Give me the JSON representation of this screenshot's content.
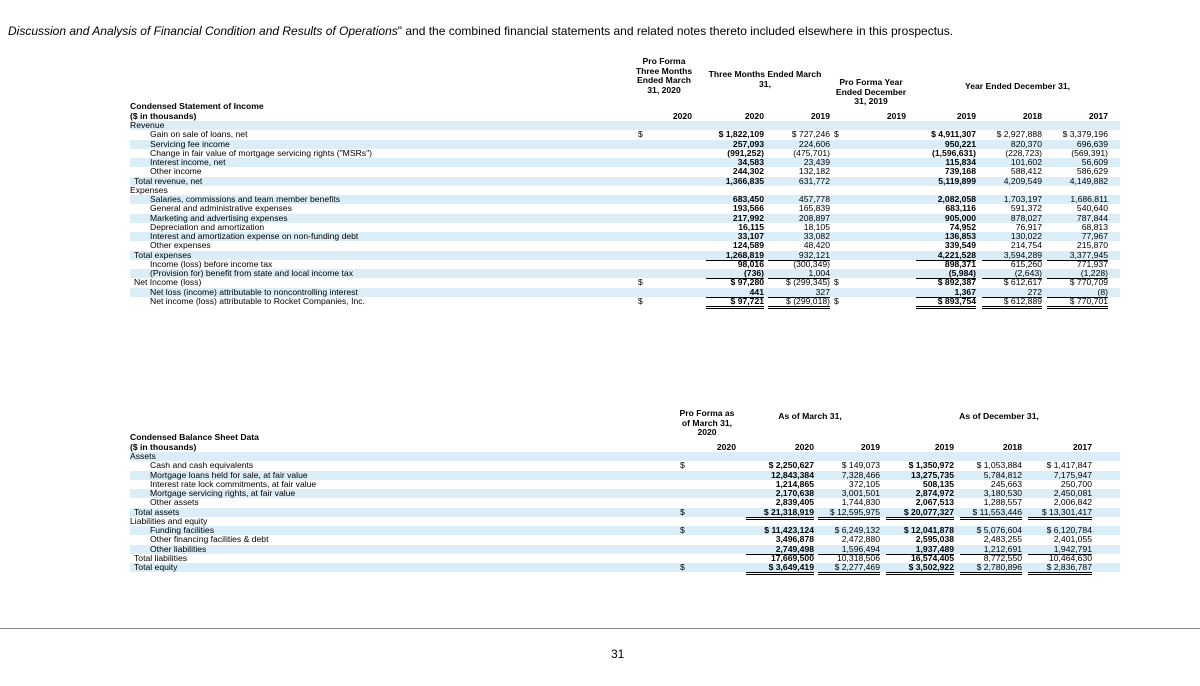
{
  "intro": {
    "italic": "Discussion and Analysis of Financial Condition and Results of Operations",
    "rest": "\" and the combined financial statements and related notes thereto included elsewhere in this prospectus."
  },
  "income": {
    "title": "Condensed Statement of Income",
    "unit": "($ in thousands)",
    "hdr_proforma_q": "Pro Forma Three Months Ended March 31, 2020",
    "hdr_three_months": "Three Months Ended March 31,",
    "hdr_proforma_y": "Pro Forma Year Ended December 31, 2019",
    "hdr_year_ended": "Year Ended December 31,",
    "cols": [
      "2020",
      "2019",
      "2019",
      "2018",
      "2017"
    ],
    "rows": [
      {
        "label": "Revenue",
        "indent": 0,
        "pf": "",
        "c2020": "",
        "c2019": "",
        "pfy": "",
        "y2019": "",
        "y2018": "",
        "y2017": ""
      },
      {
        "label": "Gain on sale of loans, net",
        "indent": 2,
        "pf": "$",
        "c2020": "$ 1,822,109",
        "c2019": "$ 727,246",
        "pfy": "$",
        "y2019": "$ 4,911,307",
        "y2018": "$ 2,927,888",
        "y2017": "$ 3,379,196"
      },
      {
        "label": "Servicing fee income",
        "indent": 2,
        "pf": "",
        "c2020": "257,093",
        "c2019": "224,606",
        "pfy": "",
        "y2019": "950,221",
        "y2018": "820,370",
        "y2017": "696,639"
      },
      {
        "label": "Change in fair value of mortgage servicing rights (\"MSRs\")",
        "indent": 2,
        "pf": "",
        "c2020": "(991,252)",
        "c2019": "(475,701)",
        "pfy": "",
        "y2019": "(1,596,631)",
        "y2018": "(228,723)",
        "y2017": "(569,391)"
      },
      {
        "label": "Interest income, net",
        "indent": 2,
        "pf": "",
        "c2020": "34,583",
        "c2019": "23,439",
        "pfy": "",
        "y2019": "115,834",
        "y2018": "101,602",
        "y2017": "56,609"
      },
      {
        "label": "Other income",
        "indent": 2,
        "pf": "",
        "c2020": "244,302",
        "c2019": "132,182",
        "pfy": "",
        "y2019": "739,168",
        "y2018": "588,412",
        "y2017": "586,629",
        "ul": true
      },
      {
        "label": "Total revenue, net",
        "indent": 1,
        "pf": "",
        "c2020": "1,366,835",
        "c2019": "631,772",
        "pfy": "",
        "y2019": "5,119,899",
        "y2018": "4,209,549",
        "y2017": "4,149,882"
      },
      {
        "label": "Expenses",
        "indent": 0,
        "pf": "",
        "c2020": "",
        "c2019": "",
        "pfy": "",
        "y2019": "",
        "y2018": "",
        "y2017": ""
      },
      {
        "label": "Salaries, commissions and team member benefits",
        "indent": 2,
        "pf": "",
        "c2020": "683,450",
        "c2019": "457,778",
        "pfy": "",
        "y2019": "2,082,058",
        "y2018": "1,703,197",
        "y2017": "1,686,811"
      },
      {
        "label": "General and administrative expenses",
        "indent": 2,
        "pf": "",
        "c2020": "193,566",
        "c2019": "165,839",
        "pfy": "",
        "y2019": "683,116",
        "y2018": "591,372",
        "y2017": "540,640"
      },
      {
        "label": "Marketing and advertising expenses",
        "indent": 2,
        "pf": "",
        "c2020": "217,992",
        "c2019": "208,897",
        "pfy": "",
        "y2019": "905,000",
        "y2018": "878,027",
        "y2017": "787,844"
      },
      {
        "label": "Depreciation and amortization",
        "indent": 2,
        "pf": "",
        "c2020": "16,115",
        "c2019": "18,105",
        "pfy": "",
        "y2019": "74,952",
        "y2018": "76,917",
        "y2017": "68,813"
      },
      {
        "label": "Interest and amortization expense on non-funding debt",
        "indent": 2,
        "pf": "",
        "c2020": "33,107",
        "c2019": "33,082",
        "pfy": "",
        "y2019": "136,853",
        "y2018": "130,022",
        "y2017": "77,967"
      },
      {
        "label": "Other expenses",
        "indent": 2,
        "pf": "",
        "c2020": "124,589",
        "c2019": "48,420",
        "pfy": "",
        "y2019": "339,549",
        "y2018": "214,754",
        "y2017": "215,870",
        "ul": true
      },
      {
        "label": "Total expenses",
        "indent": 1,
        "pf": "",
        "c2020": "1,268,819",
        "c2019": "932,121",
        "pfy": "",
        "y2019": "4,221,528",
        "y2018": "3,594,289",
        "y2017": "3,377,945",
        "ul": true
      },
      {
        "label": "Income (loss) before income tax",
        "indent": 2,
        "pf": "",
        "c2020": "98,016",
        "c2019": "(300,349)",
        "pfy": "",
        "y2019": "898,371",
        "y2018": "615,260",
        "y2017": "771,937"
      },
      {
        "label": "(Provision for) benefit from state and local income tax",
        "indent": 2,
        "pf": "",
        "c2020": "(736)",
        "c2019": "1,004",
        "pfy": "",
        "y2019": "(5,984)",
        "y2018": "(2,643)",
        "y2017": "(1,228)",
        "ul": true
      },
      {
        "label": "Net Income (loss)",
        "indent": 1,
        "pf": "$",
        "c2020": "$ 97,280",
        "c2019": "$ (299,345)",
        "pfy": "$",
        "y2019": "$ 892,387",
        "y2018": "$ 612,617",
        "y2017": "$ 770,709"
      },
      {
        "label": "Net loss (income) attributable to noncontrolling interest",
        "indent": 2,
        "pf": "",
        "c2020": "441",
        "c2019": "327",
        "pfy": "",
        "y2019": "1,367",
        "y2018": "272",
        "y2017": "(8)",
        "ul": true
      },
      {
        "label": "Net income (loss) attributable to Rocket Companies, Inc.",
        "indent": 2,
        "pf": "$",
        "c2020": "$ 97,721",
        "c2019": "$ (299,018)",
        "pfy": "$",
        "y2019": "$ 893,754",
        "y2018": "$ 612,889",
        "y2017": "$ 770,701",
        "ul2": true
      }
    ]
  },
  "balance": {
    "title": "Condensed Balance Sheet Data",
    "unit": "($ in thousands)",
    "hdr_proforma": "Pro Forma as of March 31, 2020",
    "hdr_march": "As of March 31,",
    "hdr_december": "As of December 31,",
    "cols": [
      "2020",
      "2019",
      "2019",
      "2018",
      "2017"
    ],
    "rows": [
      {
        "label": "Assets",
        "indent": 0,
        "pf": "",
        "m2020": "",
        "m2019": "",
        "d2019": "",
        "d2018": "",
        "d2017": ""
      },
      {
        "label": "Cash and cash equivalents",
        "indent": 2,
        "pf": "$",
        "m2020": "$ 2,250,627",
        "m2019": "$ 149,073",
        "d2019": "$ 1,350,972",
        "d2018": "$ 1,053,884",
        "d2017": "$ 1,417,847"
      },
      {
        "label": "Mortgage loans held for sale, at fair value",
        "indent": 2,
        "pf": "",
        "m2020": "12,843,384",
        "m2019": "7,328,466",
        "d2019": "13,275,735",
        "d2018": "5,784,812",
        "d2017": "7,175,947"
      },
      {
        "label": "Interest rate lock commitments, at fair value",
        "indent": 2,
        "pf": "",
        "m2020": "1,214,865",
        "m2019": "372,105",
        "d2019": "508,135",
        "d2018": "245,663",
        "d2017": "250,700"
      },
      {
        "label": "Mortgage servicing rights, at fair value",
        "indent": 2,
        "pf": "",
        "m2020": "2,170,638",
        "m2019": "3,001,501",
        "d2019": "2,874,972",
        "d2018": "3,180,530",
        "d2017": "2,450,081"
      },
      {
        "label": "Other assets",
        "indent": 2,
        "pf": "",
        "m2020": "2,839,405",
        "m2019": "1,744,830",
        "d2019": "2,067,513",
        "d2018": "1,288,557",
        "d2017": "2,006,842",
        "ul": true
      },
      {
        "label": "Total assets",
        "indent": 1,
        "pf": "$",
        "m2020": "$ 21,318,919",
        "m2019": "$ 12,595,975",
        "d2019": "$ 20,077,327",
        "d2018": "$ 11,553,446",
        "d2017": "$ 13,301,417",
        "ul2": true
      },
      {
        "label": "Liabilities and equity",
        "indent": 0,
        "pf": "",
        "m2020": "",
        "m2019": "",
        "d2019": "",
        "d2018": "",
        "d2017": ""
      },
      {
        "label": "Funding facilities",
        "indent": 2,
        "pf": "$",
        "m2020": "$ 11,423,124",
        "m2019": "$ 6,249,132",
        "d2019": "$ 12,041,878",
        "d2018": "$ 5,076,604",
        "d2017": "$ 6,120,784"
      },
      {
        "label": "Other financing facilities & debt",
        "indent": 2,
        "pf": "",
        "m2020": "3,496,878",
        "m2019": "2,472,880",
        "d2019": "2,595,038",
        "d2018": "2,483,255",
        "d2017": "2,401,055"
      },
      {
        "label": "Other liabilities",
        "indent": 2,
        "pf": "",
        "m2020": "2,749,498",
        "m2019": "1,596,494",
        "d2019": "1,937,489",
        "d2018": "1,212,691",
        "d2017": "1,942,791",
        "ul": true
      },
      {
        "label": "Total liabilities",
        "indent": 1,
        "pf": "",
        "m2020": "17,669,500",
        "m2019": "10,318,506",
        "d2019": "16,574,405",
        "d2018": "8,772,550",
        "d2017": "10,464,630",
        "ul": true
      },
      {
        "label": "Total equity",
        "indent": 1,
        "pf": "$",
        "m2020": "$ 3,649,419",
        "m2019": "$ 2,277,469",
        "d2019": "$ 3,502,922",
        "d2018": "$ 2,780,896",
        "d2017": "$ 2,836,787",
        "ul2": true
      }
    ]
  },
  "page_number": "31"
}
